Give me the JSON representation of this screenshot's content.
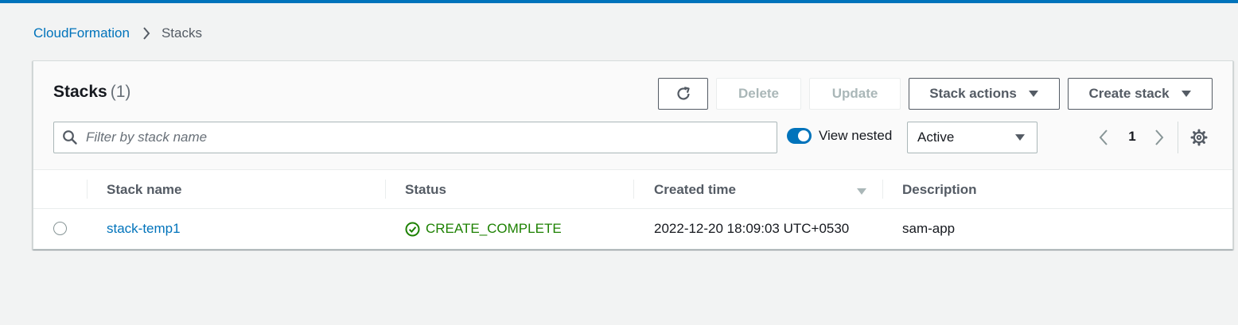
{
  "breadcrumb": {
    "root": "CloudFormation",
    "current": "Stacks"
  },
  "panel": {
    "title": "Stacks",
    "count": "(1)"
  },
  "toolbar": {
    "delete_label": "Delete",
    "update_label": "Update",
    "stack_actions_label": "Stack actions",
    "create_stack_label": "Create stack"
  },
  "search": {
    "placeholder": "Filter by stack name",
    "value": ""
  },
  "view_nested": {
    "label": "View nested",
    "enabled": true
  },
  "status_filter": {
    "selected": "Active"
  },
  "pagination": {
    "current_page": "1"
  },
  "table": {
    "columns": [
      "Stack name",
      "Status",
      "Created time",
      "Description"
    ],
    "rows": [
      {
        "stack_name": "stack-temp1",
        "status": "CREATE_COMPLETE",
        "created_time": "2022-12-20 18:09:03 UTC+0530",
        "description": "sam-app"
      }
    ]
  },
  "colors": {
    "accent": "#0073bb",
    "status_success": "#1d8102",
    "page_bg": "#f2f3f3"
  },
  "icons": [
    "chevron-right-icon",
    "refresh-icon",
    "caret-down-icon",
    "search-icon",
    "chevron-left-icon",
    "gear-icon",
    "sort-down-icon",
    "check-circle-icon"
  ]
}
